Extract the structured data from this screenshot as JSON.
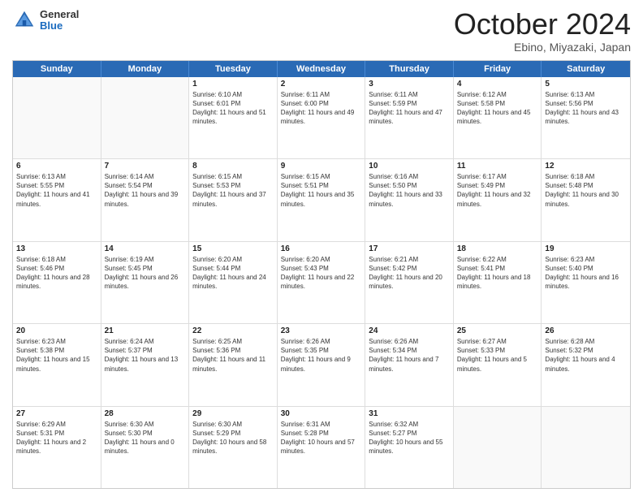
{
  "logo": {
    "general": "General",
    "blue": "Blue"
  },
  "title": "October 2024",
  "location": "Ebino, Miyazaki, Japan",
  "days": [
    "Sunday",
    "Monday",
    "Tuesday",
    "Wednesday",
    "Thursday",
    "Friday",
    "Saturday"
  ],
  "weeks": [
    [
      {
        "day": "",
        "detail": ""
      },
      {
        "day": "",
        "detail": ""
      },
      {
        "day": "1",
        "detail": "Sunrise: 6:10 AM\nSunset: 6:01 PM\nDaylight: 11 hours and 51 minutes."
      },
      {
        "day": "2",
        "detail": "Sunrise: 6:11 AM\nSunset: 6:00 PM\nDaylight: 11 hours and 49 minutes."
      },
      {
        "day": "3",
        "detail": "Sunrise: 6:11 AM\nSunset: 5:59 PM\nDaylight: 11 hours and 47 minutes."
      },
      {
        "day": "4",
        "detail": "Sunrise: 6:12 AM\nSunset: 5:58 PM\nDaylight: 11 hours and 45 minutes."
      },
      {
        "day": "5",
        "detail": "Sunrise: 6:13 AM\nSunset: 5:56 PM\nDaylight: 11 hours and 43 minutes."
      }
    ],
    [
      {
        "day": "6",
        "detail": "Sunrise: 6:13 AM\nSunset: 5:55 PM\nDaylight: 11 hours and 41 minutes."
      },
      {
        "day": "7",
        "detail": "Sunrise: 6:14 AM\nSunset: 5:54 PM\nDaylight: 11 hours and 39 minutes."
      },
      {
        "day": "8",
        "detail": "Sunrise: 6:15 AM\nSunset: 5:53 PM\nDaylight: 11 hours and 37 minutes."
      },
      {
        "day": "9",
        "detail": "Sunrise: 6:15 AM\nSunset: 5:51 PM\nDaylight: 11 hours and 35 minutes."
      },
      {
        "day": "10",
        "detail": "Sunrise: 6:16 AM\nSunset: 5:50 PM\nDaylight: 11 hours and 33 minutes."
      },
      {
        "day": "11",
        "detail": "Sunrise: 6:17 AM\nSunset: 5:49 PM\nDaylight: 11 hours and 32 minutes."
      },
      {
        "day": "12",
        "detail": "Sunrise: 6:18 AM\nSunset: 5:48 PM\nDaylight: 11 hours and 30 minutes."
      }
    ],
    [
      {
        "day": "13",
        "detail": "Sunrise: 6:18 AM\nSunset: 5:46 PM\nDaylight: 11 hours and 28 minutes."
      },
      {
        "day": "14",
        "detail": "Sunrise: 6:19 AM\nSunset: 5:45 PM\nDaylight: 11 hours and 26 minutes."
      },
      {
        "day": "15",
        "detail": "Sunrise: 6:20 AM\nSunset: 5:44 PM\nDaylight: 11 hours and 24 minutes."
      },
      {
        "day": "16",
        "detail": "Sunrise: 6:20 AM\nSunset: 5:43 PM\nDaylight: 11 hours and 22 minutes."
      },
      {
        "day": "17",
        "detail": "Sunrise: 6:21 AM\nSunset: 5:42 PM\nDaylight: 11 hours and 20 minutes."
      },
      {
        "day": "18",
        "detail": "Sunrise: 6:22 AM\nSunset: 5:41 PM\nDaylight: 11 hours and 18 minutes."
      },
      {
        "day": "19",
        "detail": "Sunrise: 6:23 AM\nSunset: 5:40 PM\nDaylight: 11 hours and 16 minutes."
      }
    ],
    [
      {
        "day": "20",
        "detail": "Sunrise: 6:23 AM\nSunset: 5:38 PM\nDaylight: 11 hours and 15 minutes."
      },
      {
        "day": "21",
        "detail": "Sunrise: 6:24 AM\nSunset: 5:37 PM\nDaylight: 11 hours and 13 minutes."
      },
      {
        "day": "22",
        "detail": "Sunrise: 6:25 AM\nSunset: 5:36 PM\nDaylight: 11 hours and 11 minutes."
      },
      {
        "day": "23",
        "detail": "Sunrise: 6:26 AM\nSunset: 5:35 PM\nDaylight: 11 hours and 9 minutes."
      },
      {
        "day": "24",
        "detail": "Sunrise: 6:26 AM\nSunset: 5:34 PM\nDaylight: 11 hours and 7 minutes."
      },
      {
        "day": "25",
        "detail": "Sunrise: 6:27 AM\nSunset: 5:33 PM\nDaylight: 11 hours and 5 minutes."
      },
      {
        "day": "26",
        "detail": "Sunrise: 6:28 AM\nSunset: 5:32 PM\nDaylight: 11 hours and 4 minutes."
      }
    ],
    [
      {
        "day": "27",
        "detail": "Sunrise: 6:29 AM\nSunset: 5:31 PM\nDaylight: 11 hours and 2 minutes."
      },
      {
        "day": "28",
        "detail": "Sunrise: 6:30 AM\nSunset: 5:30 PM\nDaylight: 11 hours and 0 minutes."
      },
      {
        "day": "29",
        "detail": "Sunrise: 6:30 AM\nSunset: 5:29 PM\nDaylight: 10 hours and 58 minutes."
      },
      {
        "day": "30",
        "detail": "Sunrise: 6:31 AM\nSunset: 5:28 PM\nDaylight: 10 hours and 57 minutes."
      },
      {
        "day": "31",
        "detail": "Sunrise: 6:32 AM\nSunset: 5:27 PM\nDaylight: 10 hours and 55 minutes."
      },
      {
        "day": "",
        "detail": ""
      },
      {
        "day": "",
        "detail": ""
      }
    ]
  ]
}
